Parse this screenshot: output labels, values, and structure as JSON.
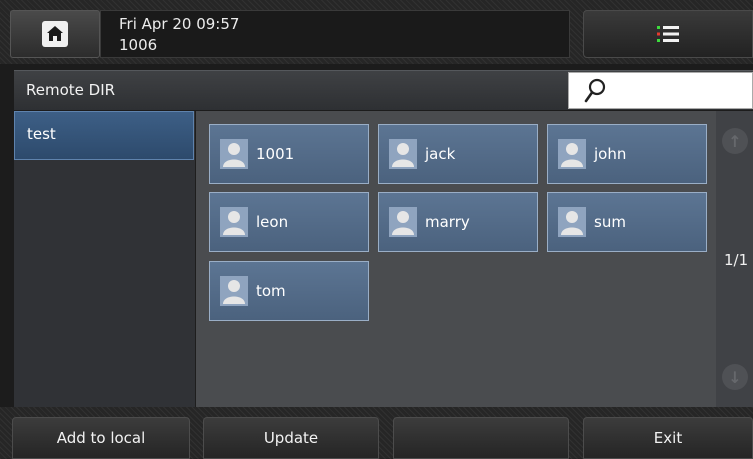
{
  "status": {
    "datetime": "Fri Apr 20 09:57",
    "extension": "1006"
  },
  "header": {
    "title": "Remote DIR",
    "search_placeholder": ""
  },
  "groups": [
    {
      "label": "test",
      "selected": true
    }
  ],
  "contacts": [
    {
      "name": "1001"
    },
    {
      "name": "jack"
    },
    {
      "name": "john"
    },
    {
      "name": "leon"
    },
    {
      "name": "marry"
    },
    {
      "name": "sum"
    },
    {
      "name": "tom"
    }
  ],
  "pagination": {
    "text": "1/1"
  },
  "softkeys": {
    "add_to_local": "Add to local",
    "update": "Update",
    "blank": "",
    "exit": "Exit"
  },
  "icons": {
    "home": "home-icon",
    "menu": "menu-list-icon",
    "search": "search-icon",
    "contact": "person-icon",
    "scroll_up": "arrow-up-icon",
    "scroll_down": "arrow-down-icon"
  },
  "colors": {
    "selection_blue": "#2d4a6c",
    "card_blue": "#5c7593",
    "menu_icon_green": "#3ddc3d",
    "menu_icon_red": "#e53b2e"
  }
}
